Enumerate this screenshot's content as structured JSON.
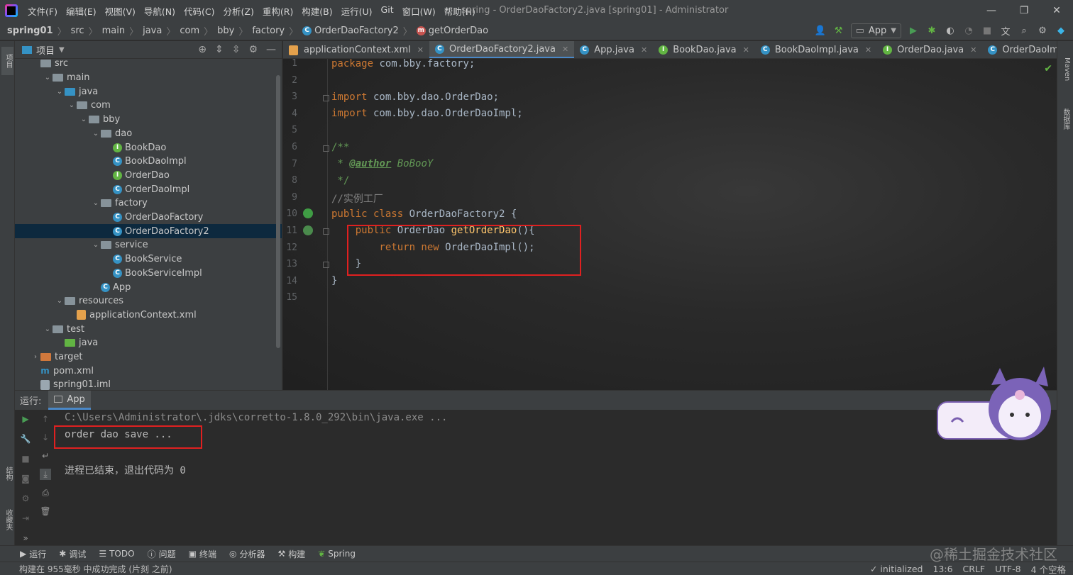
{
  "window": {
    "title": "spring - OrderDaoFactory2.java [spring01] - Administrator",
    "controls": [
      "—",
      "❐",
      "✕"
    ]
  },
  "menu": [
    "文件(F)",
    "编辑(E)",
    "视图(V)",
    "导航(N)",
    "代码(C)",
    "分析(Z)",
    "重构(R)",
    "构建(B)",
    "运行(U)",
    "Git",
    "窗口(W)",
    "帮助(H)"
  ],
  "breadcrumb": [
    "spring01",
    "src",
    "main",
    "java",
    "com",
    "bby",
    "factory",
    "OrderDaoFactory2",
    "getOrderDao"
  ],
  "run_config": "App",
  "left_strip": {
    "project": "项目",
    "structure": "结构",
    "favorites": "收藏夹"
  },
  "right_strip": {
    "maven": "Maven",
    "database": "数据库"
  },
  "project_panel": {
    "title": "项目",
    "tree": [
      {
        "label": "src",
        "depth": 2,
        "kind": "folder"
      },
      {
        "label": "main",
        "depth": 3,
        "kind": "folder",
        "expanded": true
      },
      {
        "label": "java",
        "depth": 4,
        "kind": "src",
        "expanded": true
      },
      {
        "label": "com",
        "depth": 5,
        "kind": "folder",
        "expanded": true
      },
      {
        "label": "bby",
        "depth": 6,
        "kind": "folder",
        "expanded": true
      },
      {
        "label": "dao",
        "depth": 7,
        "kind": "folder",
        "expanded": true
      },
      {
        "label": "BookDao",
        "depth": 8,
        "kind": "interface"
      },
      {
        "label": "BookDaoImpl",
        "depth": 8,
        "kind": "class"
      },
      {
        "label": "OrderDao",
        "depth": 8,
        "kind": "interface"
      },
      {
        "label": "OrderDaoImpl",
        "depth": 8,
        "kind": "class"
      },
      {
        "label": "factory",
        "depth": 7,
        "kind": "folder",
        "expanded": true
      },
      {
        "label": "OrderDaoFactory",
        "depth": 8,
        "kind": "class"
      },
      {
        "label": "OrderDaoFactory2",
        "depth": 8,
        "kind": "class",
        "selected": true
      },
      {
        "label": "service",
        "depth": 7,
        "kind": "folder",
        "expanded": true
      },
      {
        "label": "BookService",
        "depth": 8,
        "kind": "class"
      },
      {
        "label": "BookServiceImpl",
        "depth": 8,
        "kind": "class"
      },
      {
        "label": "App",
        "depth": 7,
        "kind": "class"
      },
      {
        "label": "resources",
        "depth": 4,
        "kind": "res",
        "expanded": true
      },
      {
        "label": "applicationContext.xml",
        "depth": 5,
        "kind": "xml"
      },
      {
        "label": "test",
        "depth": 3,
        "kind": "folder",
        "expanded": true
      },
      {
        "label": "java",
        "depth": 4,
        "kind": "test"
      },
      {
        "label": "target",
        "depth": 2,
        "kind": "target",
        "collapsed": true
      },
      {
        "label": "pom.xml",
        "depth": 2,
        "kind": "pom"
      },
      {
        "label": "spring01.iml",
        "depth": 2,
        "kind": "iml"
      }
    ]
  },
  "tabs": [
    {
      "label": "applicationContext.xml",
      "icon": "xml-file-icon"
    },
    {
      "label": "OrderDaoFactory2.java",
      "icon": "class-icon",
      "active": true
    },
    {
      "label": "App.java",
      "icon": "class-icon"
    },
    {
      "label": "BookDao.java",
      "icon": "interface-icon"
    },
    {
      "label": "BookDaoImpl.java",
      "icon": "class-icon"
    },
    {
      "label": "OrderDao.java",
      "icon": "interface-icon"
    },
    {
      "label": "OrderDaoImpl.java",
      "icon": "class-icon"
    },
    {
      "label": "C",
      "icon": "class-icon"
    }
  ],
  "code_lines": [
    "1",
    "2",
    "3",
    "4",
    "5",
    "6",
    "7",
    "8",
    "9",
    "10",
    "11",
    "12",
    "13",
    "14",
    "15"
  ],
  "code": {
    "l1_kw": "package",
    "l1_rest": " com.bby.factory;",
    "l3_kw": "import",
    "l3_rest": " com.bby.dao.OrderDao;",
    "l4_kw": "import",
    "l4_rest": " com.bby.dao.OrderDaoImpl;",
    "l6": "/**",
    "l7_star": " * ",
    "l7_tag": "@author",
    "l7_name": " BoBooY",
    "l8": " */",
    "l9": "//实例工厂",
    "l10_kw": "public class",
    "l10_rest": " OrderDaoFactory2 {",
    "l11_kw": "    public",
    "l11_type": " OrderDao ",
    "l11_fn": "getOrderDao",
    "l11_rest": "(){",
    "l12_kw": "        return new",
    "l12_rest": " OrderDaoImpl();",
    "l13": "    }",
    "l14": "}"
  },
  "run_panel": {
    "label": "运行:",
    "tab": "App",
    "console": [
      "C:\\Users\\Administrator\\.jdks\\corretto-1.8.0_292\\bin\\java.exe ...",
      "order dao save ...",
      "",
      "进程已结束，退出代码为 0"
    ]
  },
  "bottom_tools": [
    "运行",
    "调试",
    "TODO",
    "问题",
    "终端",
    "分析器",
    "构建",
    "Spring"
  ],
  "status": {
    "message": "构建在 955毫秒 中成功完成 (片刻 之前)",
    "right": [
      "initialized",
      "13:6",
      "CRLF",
      "UTF-8",
      "4 个空格"
    ]
  },
  "watermark": "@稀土掘金技术社区",
  "colors": {
    "accent": "#4a88c7",
    "highlight_box": "#e02020",
    "keyword": "#cc7832",
    "function": "#ffc66d"
  }
}
